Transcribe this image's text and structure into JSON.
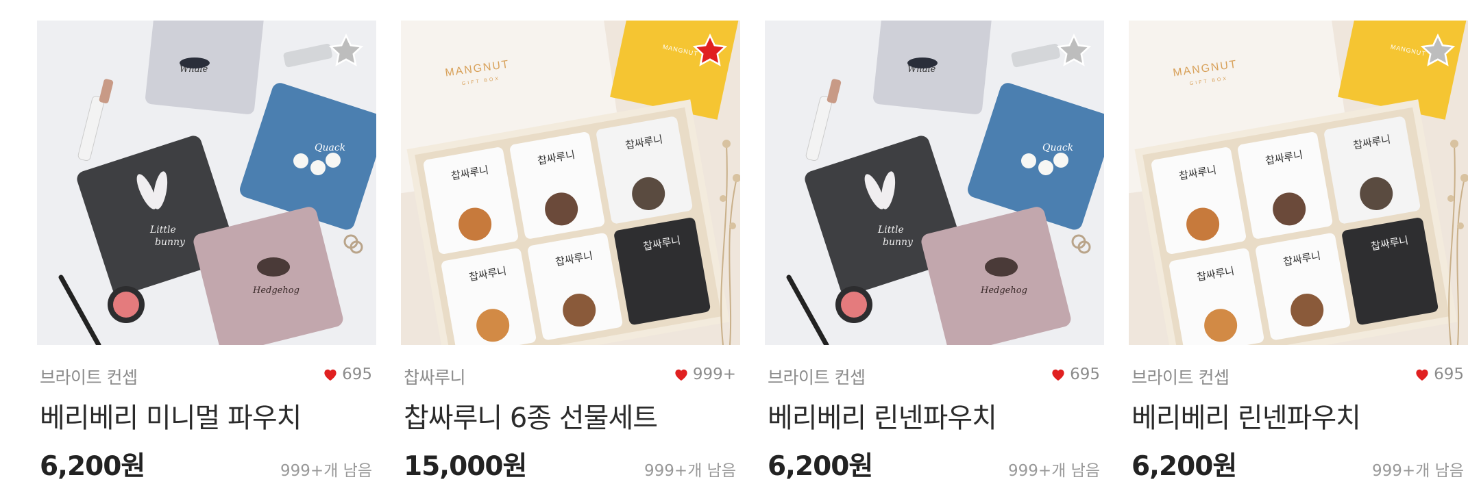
{
  "products": [
    {
      "brand": "브라이트 컨셉",
      "likes": "695",
      "name": "베리베리 미니멀 파우치",
      "price": "6,200원",
      "stock": "999+개 남음",
      "favorited": false,
      "image": "pouch-set-photo"
    },
    {
      "brand": "찹싸루니",
      "likes": "999+",
      "name": "찹싸루니 6종 선물세트",
      "price": "15,000원",
      "stock": "999+개 남음",
      "favorited": true,
      "image": "gift-box-photo"
    },
    {
      "brand": "브라이트 컨셉",
      "likes": "695",
      "name": "베리베리 린넨파우치",
      "price": "6,200원",
      "stock": "999+개 남음",
      "favorited": false,
      "image": "pouch-set-photo"
    },
    {
      "brand": "브라이트 컨셉",
      "likes": "695",
      "name": "베리베리 린넨파우치",
      "price": "6,200원",
      "stock": "999+개 남음",
      "favorited": false,
      "image": "gift-box-photo"
    }
  ],
  "image_text": {
    "box_logo": "MANGNUT",
    "box_sub": "GIFT BOX",
    "book_logo": "MANGNUT",
    "snack_label": "찹싸루니",
    "snack_brand": "MANGNUT",
    "pouch_whale": "Whale",
    "pouch_bunny_1": "Little",
    "pouch_bunny_2": "bunny",
    "pouch_duck": "Quack",
    "pouch_hedgehog": "Hedgehog"
  },
  "colors": {
    "accent_red": "#e02020",
    "star_off": "#bdbdbd",
    "heart": "#e02020"
  }
}
